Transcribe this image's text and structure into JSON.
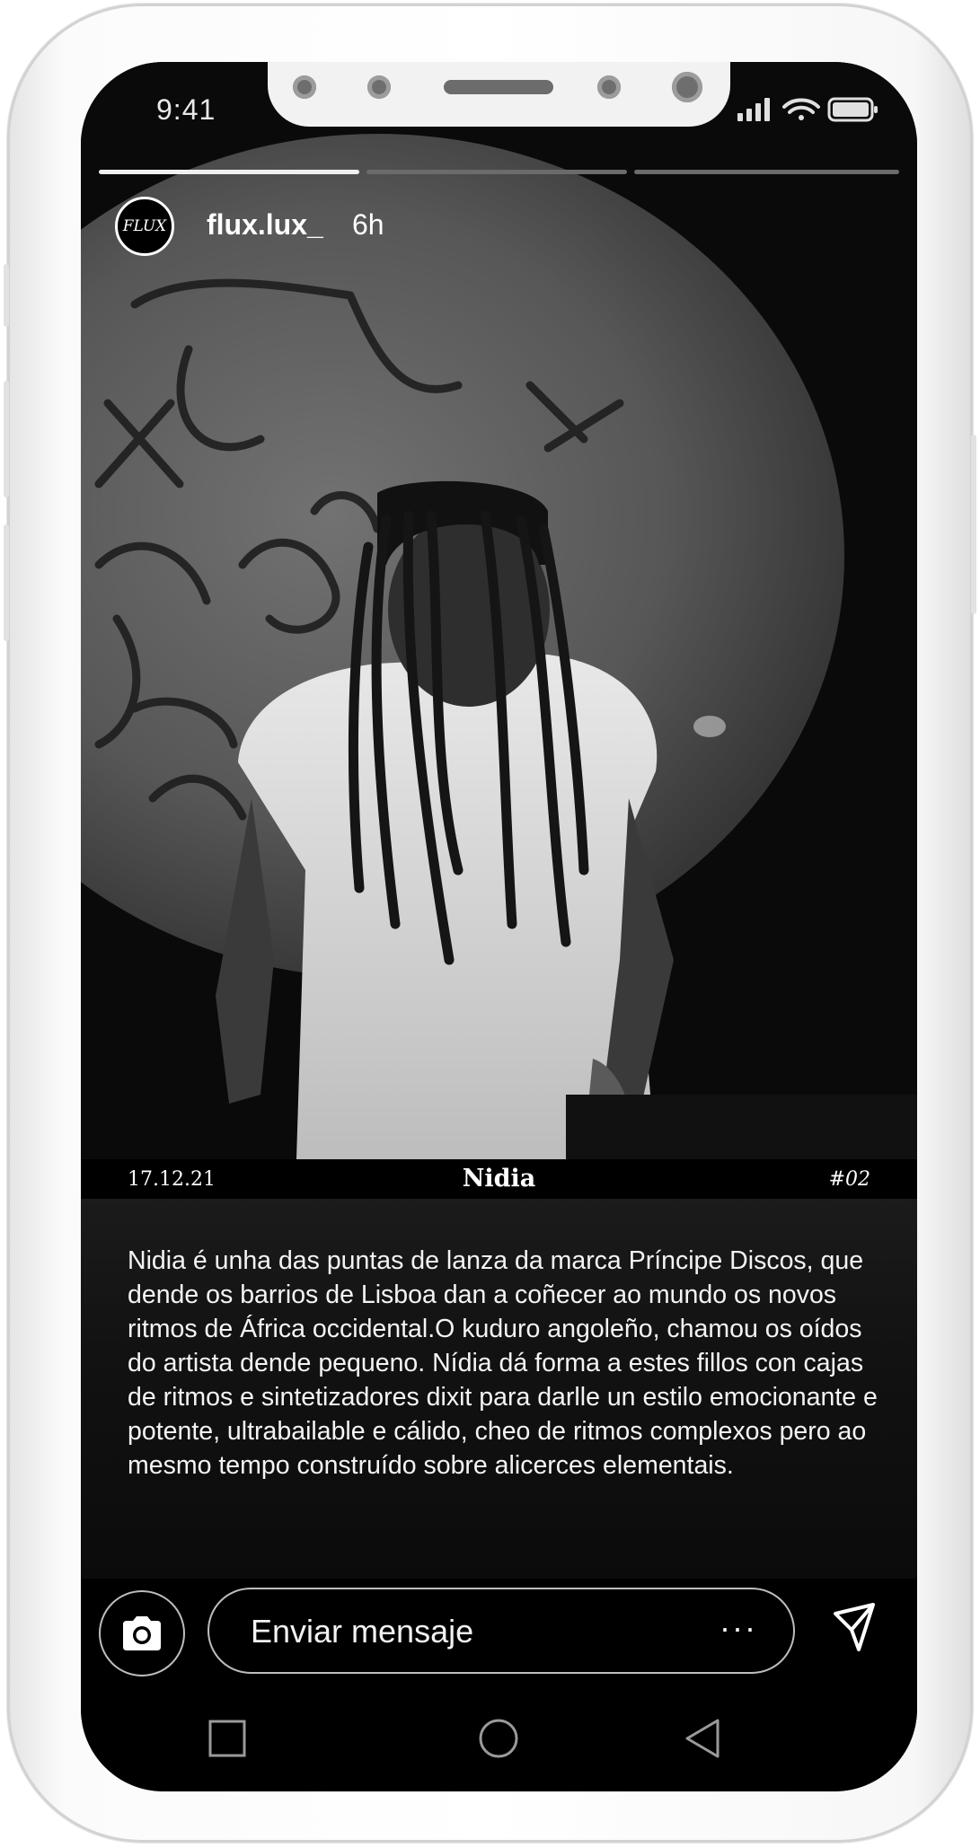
{
  "status_bar": {
    "time": "9:41",
    "icons": [
      "signal-icon",
      "wifi-icon",
      "battery-icon"
    ]
  },
  "story": {
    "progress": [
      1,
      0,
      0
    ],
    "avatar_text": "FLUX",
    "username": "flux.lux_",
    "age": "6h"
  },
  "info_bar": {
    "date": "17.12.21",
    "title": "Nidia",
    "number": "#02"
  },
  "caption": "Nidia é unha das puntas de lanza da marca Príncipe Discos, que dende os barrios de Lisboa dan a coñecer ao mundo os novos ritmos de África occidental.O kuduro angoleño, chamou os oídos do artista dende pequeno. Nídia dá forma a estes fillos con cajas de ritmos e sintetizadores dixit para darlle un estilo emocionante e potente, ultrabailable e cálido, cheo de ritmos complexos pero ao mesmo tempo construído sobre alicerces elementais.",
  "reply": {
    "placeholder": "Enviar mensaje",
    "more_label": "···"
  },
  "icons": {
    "camera": "camera-icon",
    "send": "send-icon",
    "more": "more-icon"
  },
  "nav": [
    "recents-icon",
    "home-icon",
    "back-icon"
  ],
  "colors": {
    "background": "#000000",
    "text": "#ffffff",
    "frame": "#f5f5f5",
    "border": "#bdbdbd"
  }
}
